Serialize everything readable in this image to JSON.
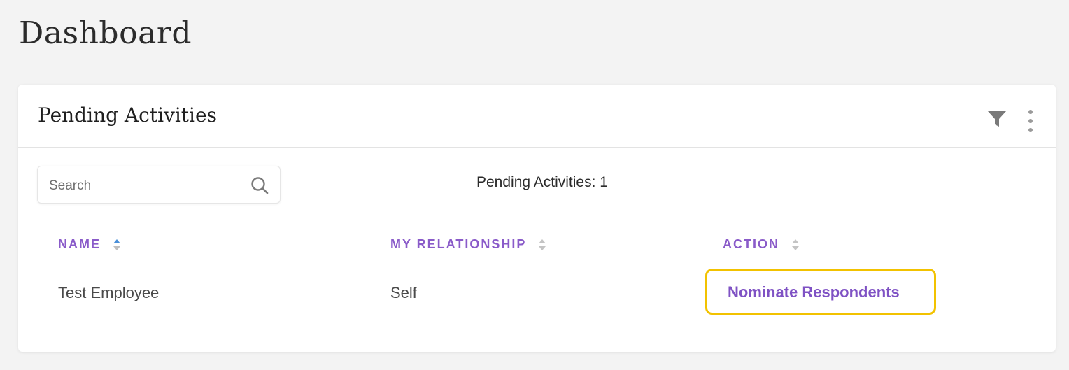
{
  "page": {
    "title": "Dashboard"
  },
  "card": {
    "title": "Pending Activities",
    "filter_icon": "filter-icon",
    "more_icon": "more-vertical-icon"
  },
  "search": {
    "placeholder": "Search",
    "value": "",
    "icon": "search-icon"
  },
  "summary": {
    "pending_count_text": "Pending Activities: 1"
  },
  "table": {
    "columns": [
      {
        "label": "NAME",
        "sort": "ascending",
        "sort_color": "#4a90d9"
      },
      {
        "label": "MY RELATIONSHIP",
        "sort": "none"
      },
      {
        "label": "ACTION",
        "sort": "none"
      }
    ],
    "rows": [
      {
        "name": "Test Employee",
        "relationship": "Self",
        "action": "Nominate Respondents"
      }
    ]
  },
  "colors": {
    "accent_purple": "#8a5bc9",
    "highlight_yellow": "#f2c200",
    "background": "#f3f3f3"
  }
}
